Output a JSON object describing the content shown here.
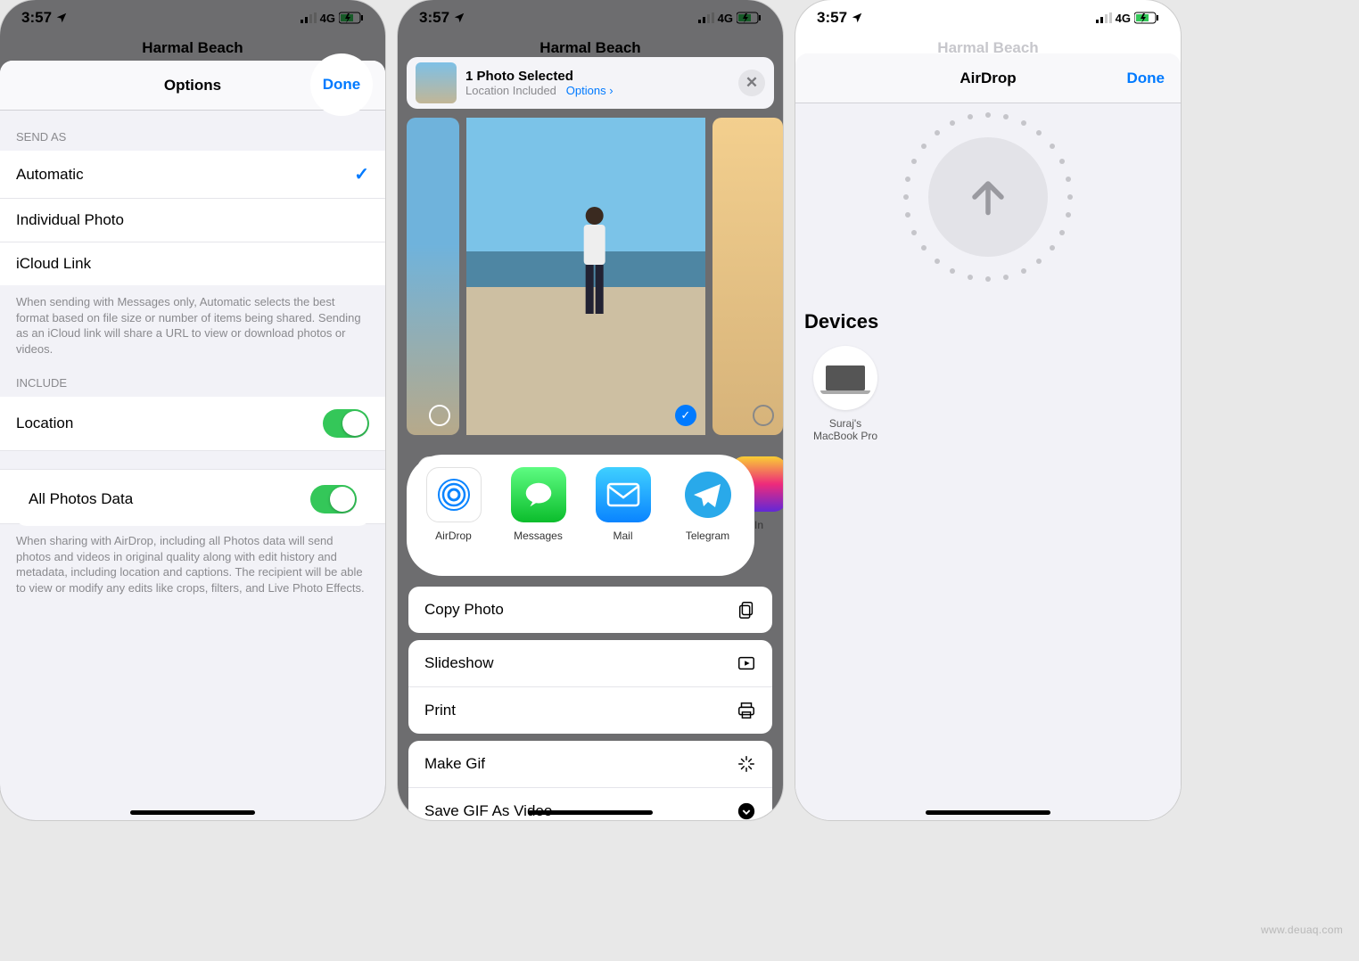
{
  "status": {
    "time": "3:57",
    "network": "4G"
  },
  "bgTitle": "Harmal Beach",
  "screen1": {
    "sheetTitle": "Options",
    "done": "Done",
    "section1": "SEND AS",
    "opts": [
      "Automatic",
      "Individual Photo",
      "iCloud Link"
    ],
    "note1": "When sending with Messages only, Automatic selects the best format based on file size or number of items being shared. Sending as an iCloud link will share a URL to view or download photos or videos.",
    "section2": "INCLUDE",
    "location": "Location",
    "allPhotos": "All Photos Data",
    "note2": "When sharing with AirDrop, including all Photos data will send photos and videos in original quality along with edit history and metadata, including location and captions. The recipient will be able to view or modify any edits like crops, filters, and Live Photo Effects."
  },
  "screen2": {
    "headerL1": "1 Photo Selected",
    "headerL2a": "Location Included",
    "headerL2b": "Options",
    "apps": [
      "AirDrop",
      "Messages",
      "Mail",
      "Telegram",
      "In"
    ],
    "actions": {
      "copy": "Copy Photo",
      "slideshow": "Slideshow",
      "print": "Print",
      "makegif": "Make Gif",
      "savegif": "Save GIF As Video"
    }
  },
  "screen3": {
    "title": "AirDrop",
    "done": "Done",
    "devicesH": "Devices",
    "dev1a": "Suraj's",
    "dev1b": "MacBook Pro"
  },
  "watermark": "www.deuaq.com"
}
